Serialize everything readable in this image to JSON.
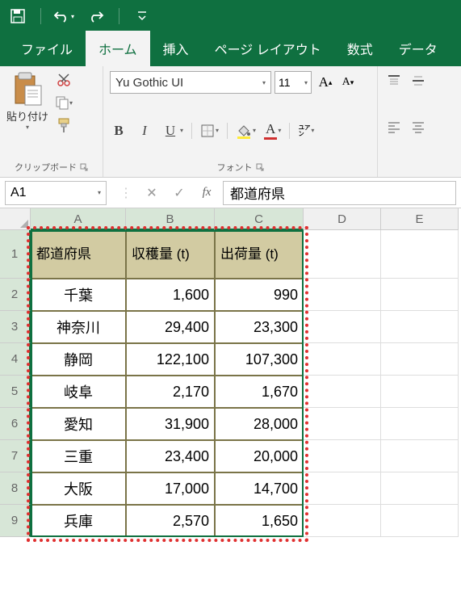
{
  "qat": {
    "save": "save-icon",
    "undo": "undo-icon",
    "redo": "redo-icon"
  },
  "tabs": {
    "file": "ファイル",
    "home": "ホーム",
    "insert": "挿入",
    "pagelayout": "ページ レイアウト",
    "formulas": "数式",
    "data": "データ"
  },
  "ribbon": {
    "clipboard": {
      "paste": "貼り付け",
      "group_label": "クリップボード"
    },
    "font": {
      "name": "Yu Gothic UI",
      "size": "11",
      "bold": "B",
      "italic": "I",
      "underline": "U",
      "grow": "A",
      "shrink": "A",
      "group_label": "フォント"
    }
  },
  "formula_bar": {
    "name_box": "A1",
    "formula_value": "都道府県"
  },
  "columns": [
    "A",
    "B",
    "C",
    "D",
    "E"
  ],
  "table": {
    "headers": {
      "pref": "都道府県",
      "harvest": "収穫量 (t)",
      "ship": "出荷量 (t)"
    },
    "rows": [
      {
        "pref": "千葉",
        "harvest": "1,600",
        "ship": "990"
      },
      {
        "pref": "神奈川",
        "harvest": "29,400",
        "ship": "23,300"
      },
      {
        "pref": "静岡",
        "harvest": "122,100",
        "ship": "107,300"
      },
      {
        "pref": "岐阜",
        "harvest": "2,170",
        "ship": "1,670"
      },
      {
        "pref": "愛知",
        "harvest": "31,900",
        "ship": "28,000"
      },
      {
        "pref": "三重",
        "harvest": "23,400",
        "ship": "20,000"
      },
      {
        "pref": "大阪",
        "harvest": "17,000",
        "ship": "14,700"
      },
      {
        "pref": "兵庫",
        "harvest": "2,570",
        "ship": "1,650"
      }
    ]
  }
}
